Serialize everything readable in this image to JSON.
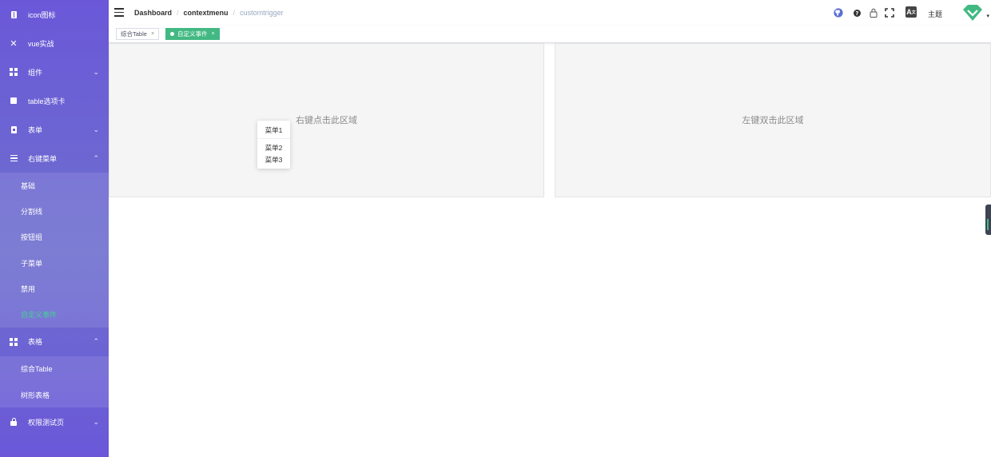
{
  "sidebar": {
    "items": [
      {
        "label": "icon图标",
        "icon": "book-icon"
      },
      {
        "label": "vue实战",
        "icon": "close-x-icon"
      },
      {
        "label": "组件",
        "icon": "grid-icon",
        "arrow": "⌄"
      },
      {
        "label": "table选项卡",
        "icon": "square-icon"
      },
      {
        "label": "表单",
        "icon": "document-icon",
        "arrow": "⌄"
      },
      {
        "label": "右键菜单",
        "icon": "list-icon",
        "arrow": "⌃"
      },
      {
        "label": "表格",
        "icon": "grid-icon",
        "arrow": "⌃"
      },
      {
        "label": "权限测试页",
        "icon": "lock-icon",
        "arrow": "⌄"
      }
    ],
    "contextmenu_sub": [
      "基础",
      "分割线",
      "按钮组",
      "子菜单",
      "禁用",
      "自定义事件"
    ],
    "table_sub": [
      "综合Table",
      "树形表格"
    ]
  },
  "header": {
    "breadcrumb": [
      "Dashboard",
      "contextmenu",
      "customtrigger"
    ],
    "theme_label": "主题",
    "lang_icon_text": "A"
  },
  "tags": {
    "items": [
      "综合Table",
      "自定义事件"
    ]
  },
  "panels": {
    "left_text": "右键点击此区域",
    "right_text": "左键双击此区域"
  },
  "context_menu": {
    "items": [
      "菜单1",
      "菜单2",
      "菜单3"
    ]
  },
  "colors": {
    "sidebar": "#6a58d8",
    "accent_green": "#42b983",
    "active_sub": "#42d392"
  }
}
